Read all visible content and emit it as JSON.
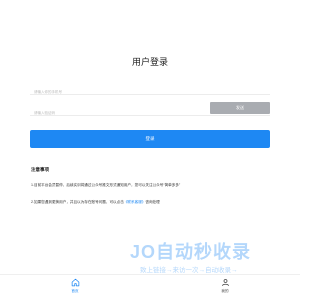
{
  "page": {
    "title": "用户登录"
  },
  "form": {
    "phone_placeholder": "请输入你的手机号",
    "code_placeholder": "请输入验证码",
    "send_code_label": "发送",
    "login_label": "登录"
  },
  "notes": {
    "title": "注意事项",
    "item1": "1.目前平台会员暂停，后续实训将通过公众号推文形式通知用户，您可以关注公众号“简单多多”",
    "item2_prefix": "2.如果您遇到更换用户，并且以为存在账号问题，可以点击",
    "item2_link": "《联系客服》",
    "item2_suffix": "咨询处理"
  },
  "watermark": {
    "main": "JO自动秒收录",
    "sub": "致上链接→来访一次→自动收录→"
  },
  "tabbar": {
    "home_label": "首页",
    "mine_label": "我的"
  },
  "colors": {
    "accent": "#1e88f3",
    "send_button": "#a9acb1"
  }
}
